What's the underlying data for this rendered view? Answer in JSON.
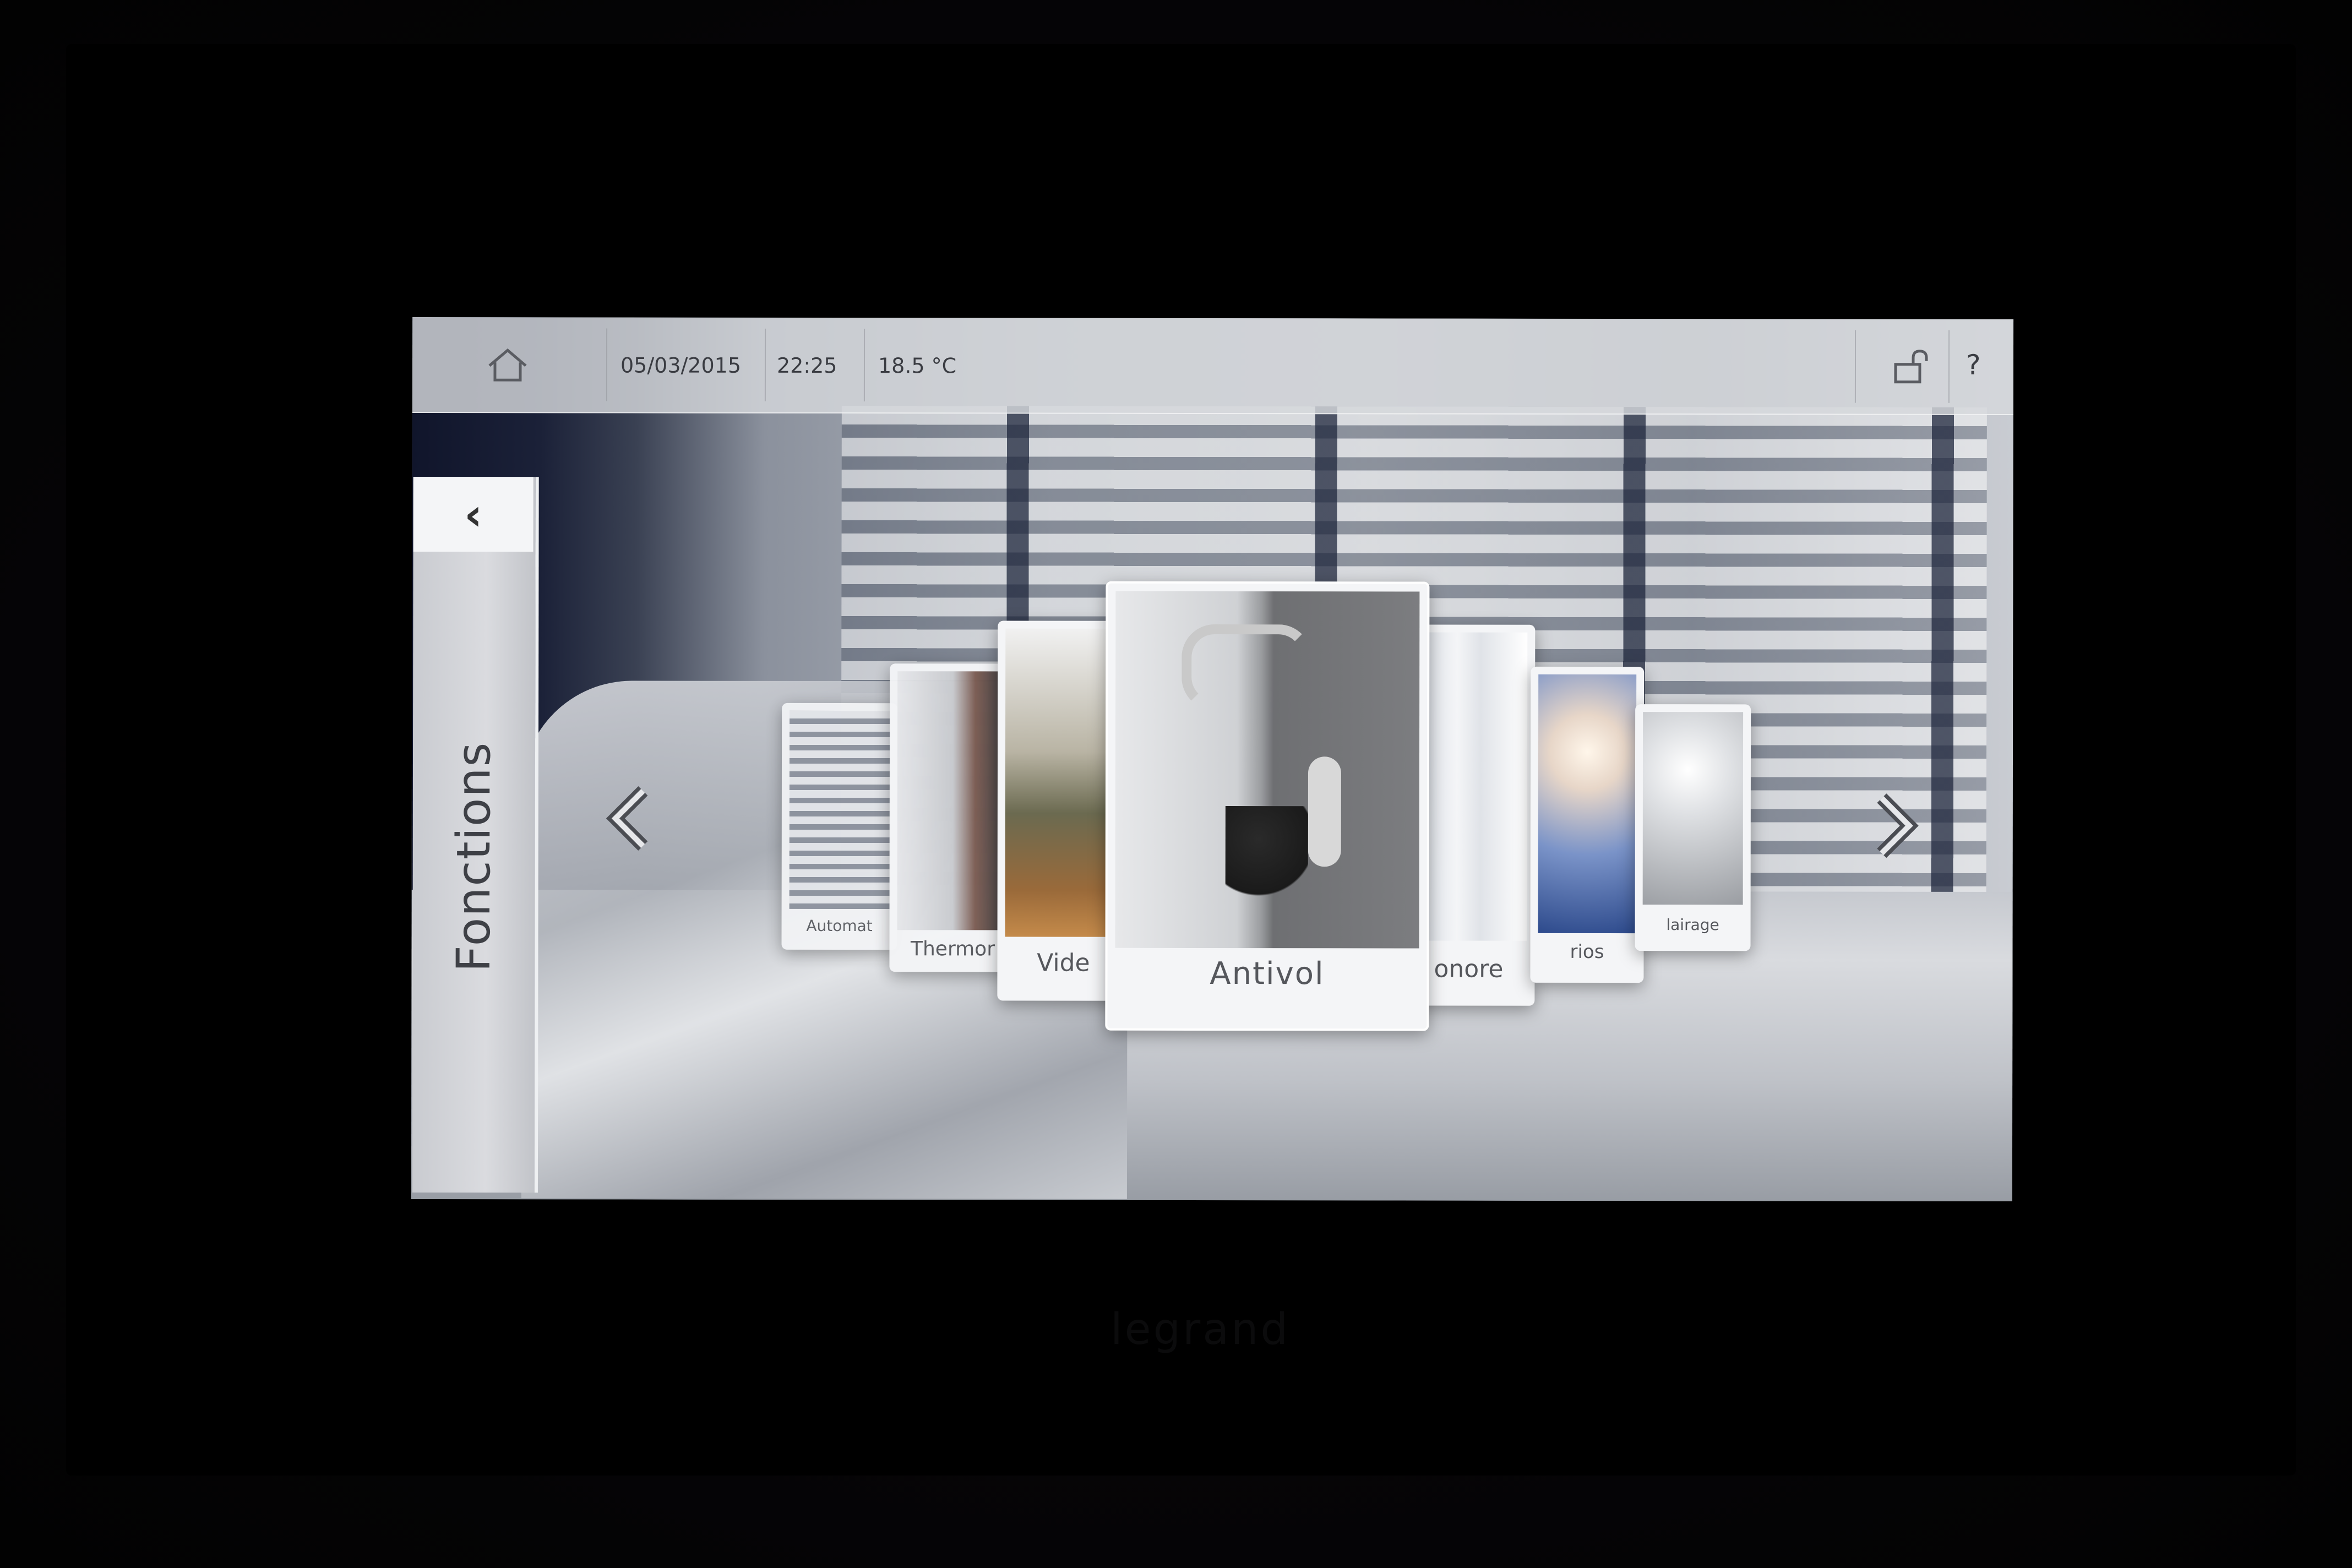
{
  "topbar": {
    "date": "05/03/2015",
    "time": "22:25",
    "temperature": "18.5 °C",
    "help_label": "?"
  },
  "sidebar": {
    "title": "Fonctions",
    "back_label": "‹"
  },
  "carousel": {
    "items": [
      {
        "label": "Automat"
      },
      {
        "label": "Thermor"
      },
      {
        "label": "Vide"
      },
      {
        "label": "Antivol"
      },
      {
        "label": "onore"
      },
      {
        "label": "rios"
      },
      {
        "label": "lairage"
      }
    ],
    "selected_index": 3,
    "prev_label": "❮",
    "next_label": "❯"
  },
  "device": {
    "brand": "legrand"
  },
  "colors": {
    "topbar_bg": "#d6d8dc",
    "card_bg": "#f4f5f7",
    "text": "#3a3c42"
  }
}
